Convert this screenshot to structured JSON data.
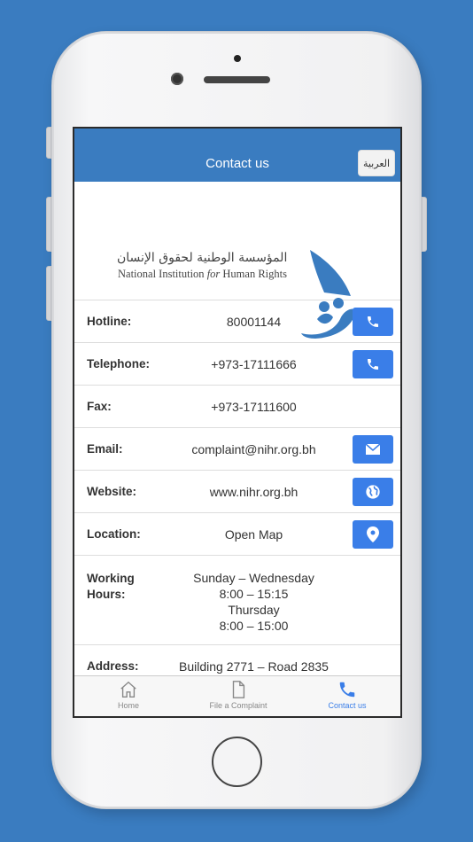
{
  "header": {
    "title": "Contact us",
    "language_button": "العربية"
  },
  "logo": {
    "arabic_name": "المؤسسة الوطنية لحقوق الإنسان",
    "english_name_part1": "National Institution ",
    "english_name_part2": "for",
    "english_name_part3": " Human Rights"
  },
  "contact_rows": [
    {
      "label": "Hotline:",
      "value": "80001144",
      "action_icon": "phone-icon"
    },
    {
      "label": "Telephone:",
      "value": "+973-17111666",
      "action_icon": "phone-icon"
    },
    {
      "label": "Fax:",
      "value": "+973-17111600"
    },
    {
      "label": "Email:",
      "value": "complaint@nihr.org.bh",
      "action_icon": "mail-icon"
    },
    {
      "label": "Website:",
      "value": "www.nihr.org.bh",
      "action_icon": "globe-icon"
    },
    {
      "label": "Location:",
      "value": "Open Map",
      "action_icon": "map-pin-icon"
    }
  ],
  "working_hours": {
    "label_line1": "Working",
    "label_line2": "Hours:",
    "lines": [
      "Sunday – Wednesday",
      "8:00 – 15:15",
      "Thursday",
      "8:00 – 15:00"
    ]
  },
  "address": {
    "label": "Address:",
    "line1": "Building 2771 – Road 2835"
  },
  "tabs": [
    {
      "label": "Home",
      "icon": "home-icon",
      "active": false
    },
    {
      "label": "File a Complaint",
      "icon": "document-icon",
      "active": false
    },
    {
      "label": "Contact us",
      "icon": "phone-icon",
      "active": true
    }
  ],
  "colors": {
    "brand_blue": "#3a7cc0",
    "action_blue": "#3a7ee8"
  }
}
